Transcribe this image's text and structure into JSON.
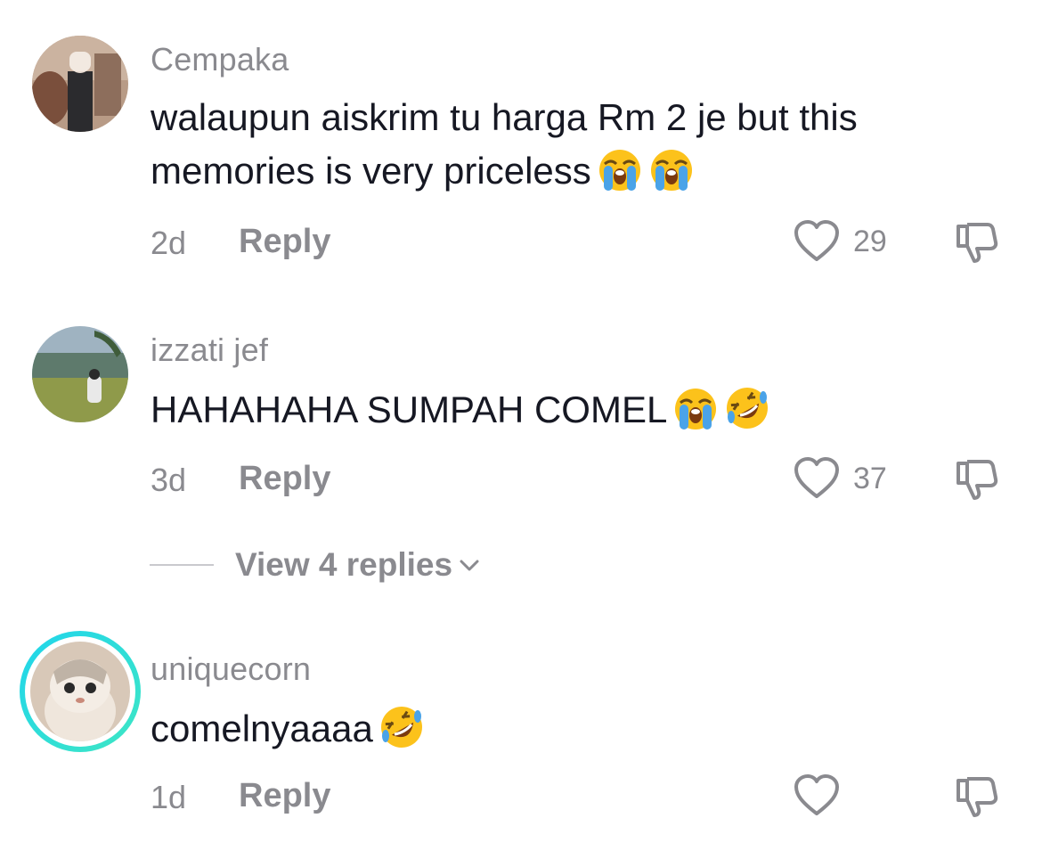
{
  "comments": [
    {
      "username": "Cempaka",
      "text": "walaupun aiskrim tu harga Rm 2 je but this memories is very priceless",
      "emojis": [
        "loudly-crying-face-emoji",
        "loudly-crying-face-emoji"
      ],
      "time": "2d",
      "reply_label": "Reply",
      "likes": "29"
    },
    {
      "username": "izzati jef",
      "text": "HAHAHAHA SUMPAH COMEL",
      "emojis": [
        "loudly-crying-face-emoji",
        "rolling-on-floor-laughing-emoji"
      ],
      "time": "3d",
      "reply_label": "Reply",
      "likes": "37",
      "view_replies_label": "View 4 replies"
    },
    {
      "username": "uniquecorn",
      "text": "comelnyaaaa",
      "emojis": [
        "rolling-on-floor-laughing-emoji"
      ],
      "time": "1d",
      "reply_label": "Reply",
      "likes": ""
    }
  ],
  "colors": {
    "secondary_text": "#8a8a8f",
    "primary_text": "#161823",
    "story_ring_start": "#20d5ec",
    "story_ring_end": "#3ee6c4"
  }
}
